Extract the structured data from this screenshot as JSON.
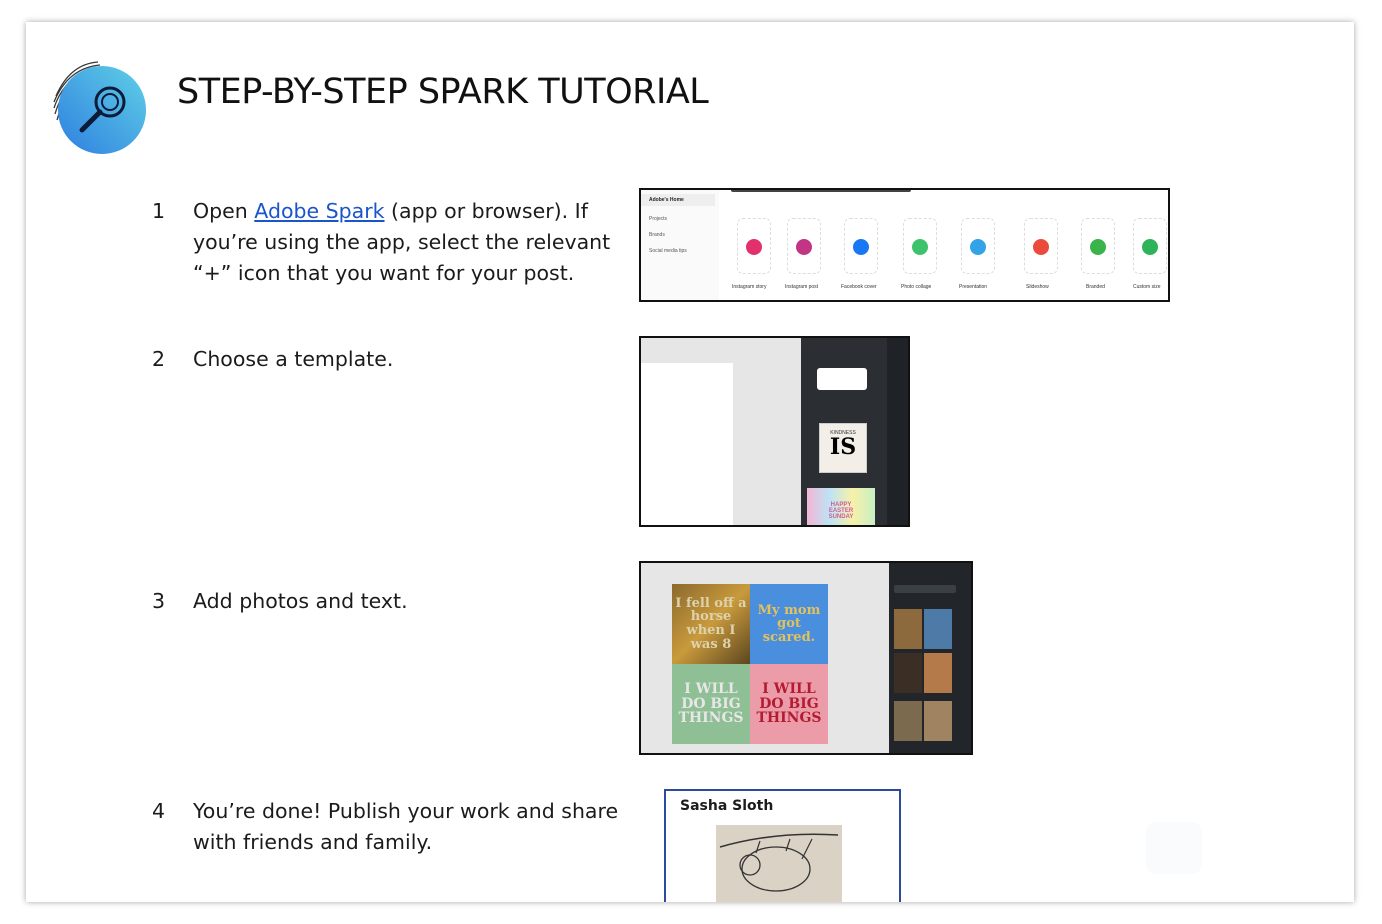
{
  "header": {
    "title": "STEP-BY-STEP SPARK TUTORIAL",
    "logo_icon": "magnifying-glass-icon",
    "accent_color": "#2c8fd6"
  },
  "steps": [
    {
      "number": "1",
      "text_before": "Open ",
      "link": "Adobe Spark",
      "text_after": " (app or browser). If you’re using the app, select the relevant “+” icon that you want for your post."
    },
    {
      "number": "2",
      "text": "Choose a template."
    },
    {
      "number": "3",
      "text": "Add photos and text."
    },
    {
      "number": "4",
      "text": "You’re done! Publish your work and share with friends and family."
    }
  ],
  "shot1": {
    "sidebar": [
      "Adobe's Home",
      "Projects",
      "Brands",
      "Social media tips"
    ],
    "options": [
      "Instagram story",
      "Instagram post",
      "Facebook cover",
      "Photo collage",
      "Presentation",
      "Slideshow",
      "Branded",
      "Custom size"
    ]
  },
  "shot2": {
    "template_text": "IS",
    "template_small": "KINDNESS",
    "template2_text": "HAPPY EASTER SUNDAY"
  },
  "shot3": {
    "tiles": [
      "I fell off a horse when I was 8",
      "My mom got scared.",
      "I WILL DO BIG THINGS",
      "I WILL DO BIG THINGS"
    ]
  },
  "shot4": {
    "name": "Sasha Sloth"
  }
}
